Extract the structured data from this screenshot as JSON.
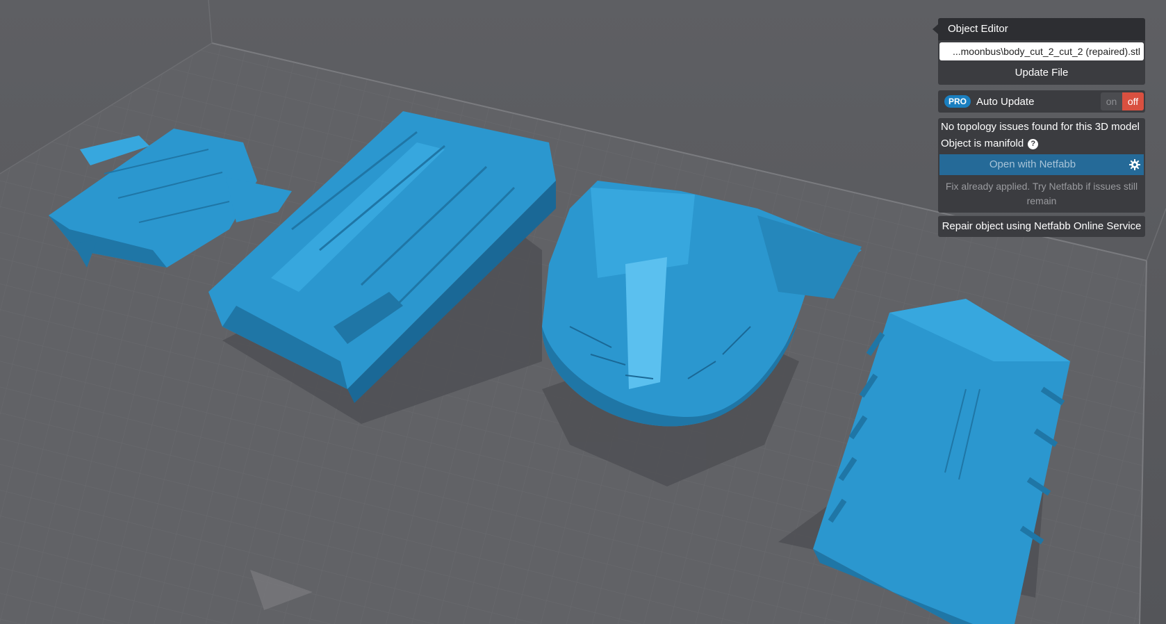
{
  "editor": {
    "title": "Object Editor",
    "file_path": "...moonbus\\body_cut_2_cut_2 (repaired).stl",
    "update_label": "Update File"
  },
  "auto_update": {
    "badge": "PRO",
    "label": "Auto Update",
    "on_label": "on",
    "off_label": "off"
  },
  "topology": {
    "status": "No topology issues found for this 3D model",
    "manifold": "Object is manifold",
    "help_icon": "?",
    "netfabb_label": "Open with Netfabb",
    "hint": "Fix already applied. Try Netfabb if issues still remain",
    "repair_label": "Repair object using Netfabb Online Service"
  },
  "icons": {
    "settings": "gear-icon",
    "help": "question-circle-icon"
  },
  "colors": {
    "model": "#2b97cf",
    "background": "#5b5c60",
    "panel": "#3b3c40",
    "accent": "#256a98",
    "toggle_off": "#d95040"
  }
}
